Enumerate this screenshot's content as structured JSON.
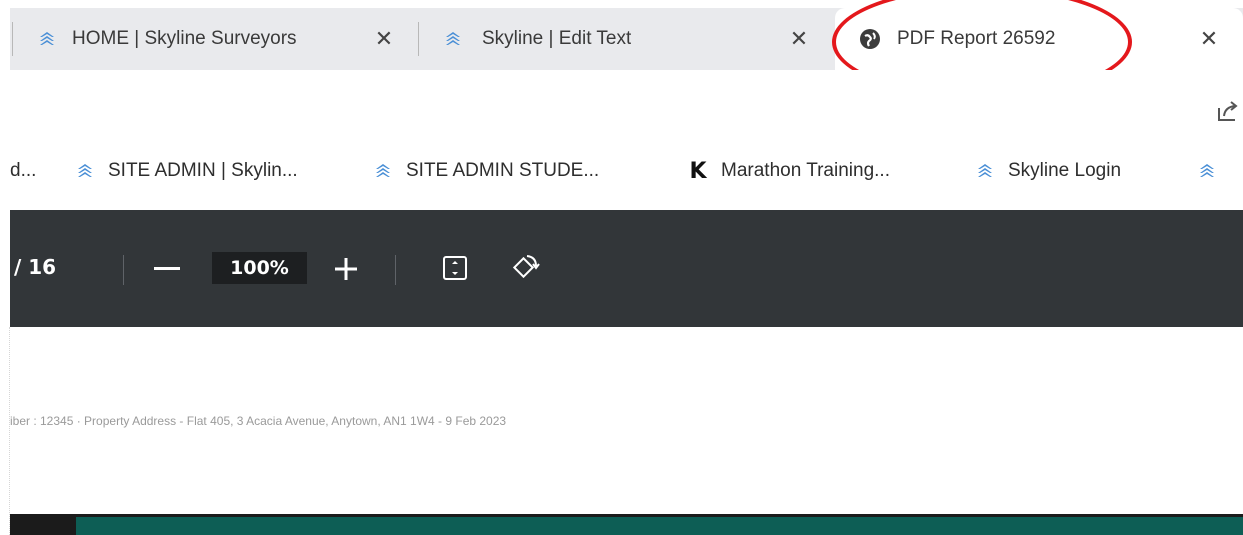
{
  "tabs": [
    {
      "title": "HOME | Skyline Surveyors",
      "icon": "skyline-logo-icon",
      "active": false
    },
    {
      "title": "Skyline | Edit Text",
      "icon": "skyline-logo-icon",
      "active": false
    },
    {
      "title": "PDF Report 26592",
      "icon": "globe-icon",
      "active": true
    }
  ],
  "tab_close_glyph": "✕",
  "bookmarks": [
    {
      "label": "d...",
      "icon": null
    },
    {
      "label": "SITE ADMIN | Skylin...",
      "icon": "skyline-logo-icon"
    },
    {
      "label": "SITE ADMIN STUDE...",
      "icon": "skyline-logo-icon"
    },
    {
      "label": "Marathon Training...",
      "icon": "k-logo-icon",
      "icon_text": "K"
    },
    {
      "label": "Skyline Login",
      "icon": "skyline-logo-icon"
    }
  ],
  "pdf_toolbar": {
    "page_total": "/ 16",
    "zoom_out_glyph": "—",
    "zoom_value": "100%",
    "zoom_in_glyph": "+"
  },
  "document": {
    "header_line": "iber : 12345 · Property Address - Flat 405, 3 Acacia Avenue, Anytown, AN1 1W4 - 9 Feb 2023"
  },
  "colors": {
    "highlight": "#e4181c",
    "toolbar_bg": "#323639",
    "brand_teal": "#0d5e55",
    "skyline_blue": "#4a8fd6"
  }
}
